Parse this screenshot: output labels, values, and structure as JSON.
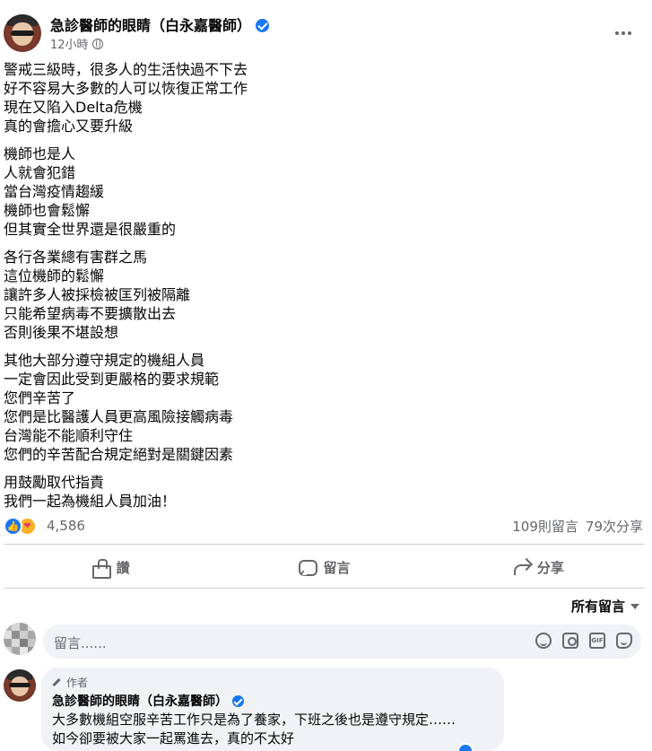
{
  "post": {
    "author": "急診醫師的眼睛（白永嘉醫師）",
    "time": "12小時",
    "body": [
      [
        "警戒三級時，很多人的生活快過不下去",
        "好不容易大多數的人可以恢復正常工作",
        "現在又陷入Delta危機",
        "真的會擔心又要升級"
      ],
      [
        "機師也是人",
        "人就會犯錯",
        "當台灣疫情趨緩",
        "機師也會鬆懈",
        "但其實全世界還是很嚴重的"
      ],
      [
        "各行各業總有害群之馬",
        "這位機師的鬆懈",
        "讓許多人被採檢被匡列被隔離",
        "只能希望病毒不要擴散出去",
        "否則後果不堪設想"
      ],
      [
        "其他大部分遵守規定的機組人員",
        "一定會因此受到更嚴格的要求規範",
        "您們辛苦了",
        "您們是比醫護人員更高風險接觸病毒",
        "台灣能不能順利守住",
        "您們的辛苦配合規定絕對是關鍵因素"
      ],
      [
        "用鼓勵取代指責",
        "我們一起為機組人員加油！"
      ]
    ]
  },
  "stats": {
    "reaction_count": "4,586",
    "comments": "109則留言",
    "shares": "79次分享"
  },
  "actions": {
    "like": "讚",
    "comment": "留言",
    "share": "分享"
  },
  "comments_section": {
    "filter": "所有留言",
    "placeholder": "留言......"
  },
  "reply": {
    "tag": "作者",
    "author": "急診醫師的眼睛（白永嘉醫師）",
    "lines": [
      "大多數機組空服辛苦工作只是為了養家，下班之後也是遵守規定……",
      "如今卻要被大家一起罵進去，真的不太好"
    ]
  },
  "colors": {
    "accent": "#1877f2",
    "secondary_text": "#65676b",
    "bubble": "#f0f2f5"
  }
}
